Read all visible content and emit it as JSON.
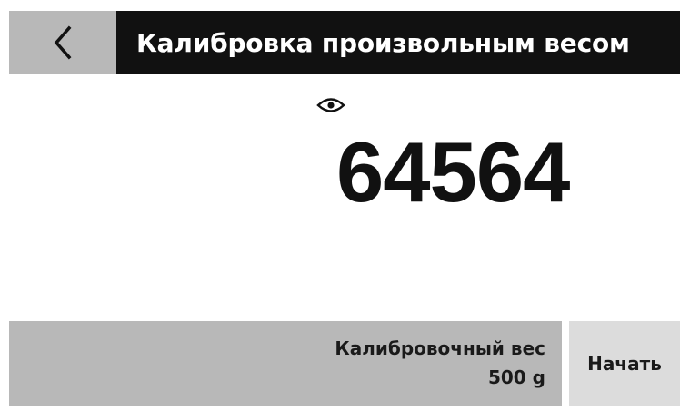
{
  "header": {
    "back_icon": "chevron-left-icon",
    "title": "Калибровка произвольным весом"
  },
  "main": {
    "stability_icon": "eye-icon",
    "weight_value": "64564"
  },
  "footer": {
    "calibration_weight_label": "Калибровочный вес",
    "calibration_weight_value": "500 g",
    "start_label": "Начать"
  },
  "colors": {
    "title_bar_bg": "#111111",
    "back_button_bg": "#b8b8b8",
    "calib_panel_bg": "#b8b8b8",
    "start_button_bg": "#dcdcdc",
    "text_dark": "#111111"
  }
}
